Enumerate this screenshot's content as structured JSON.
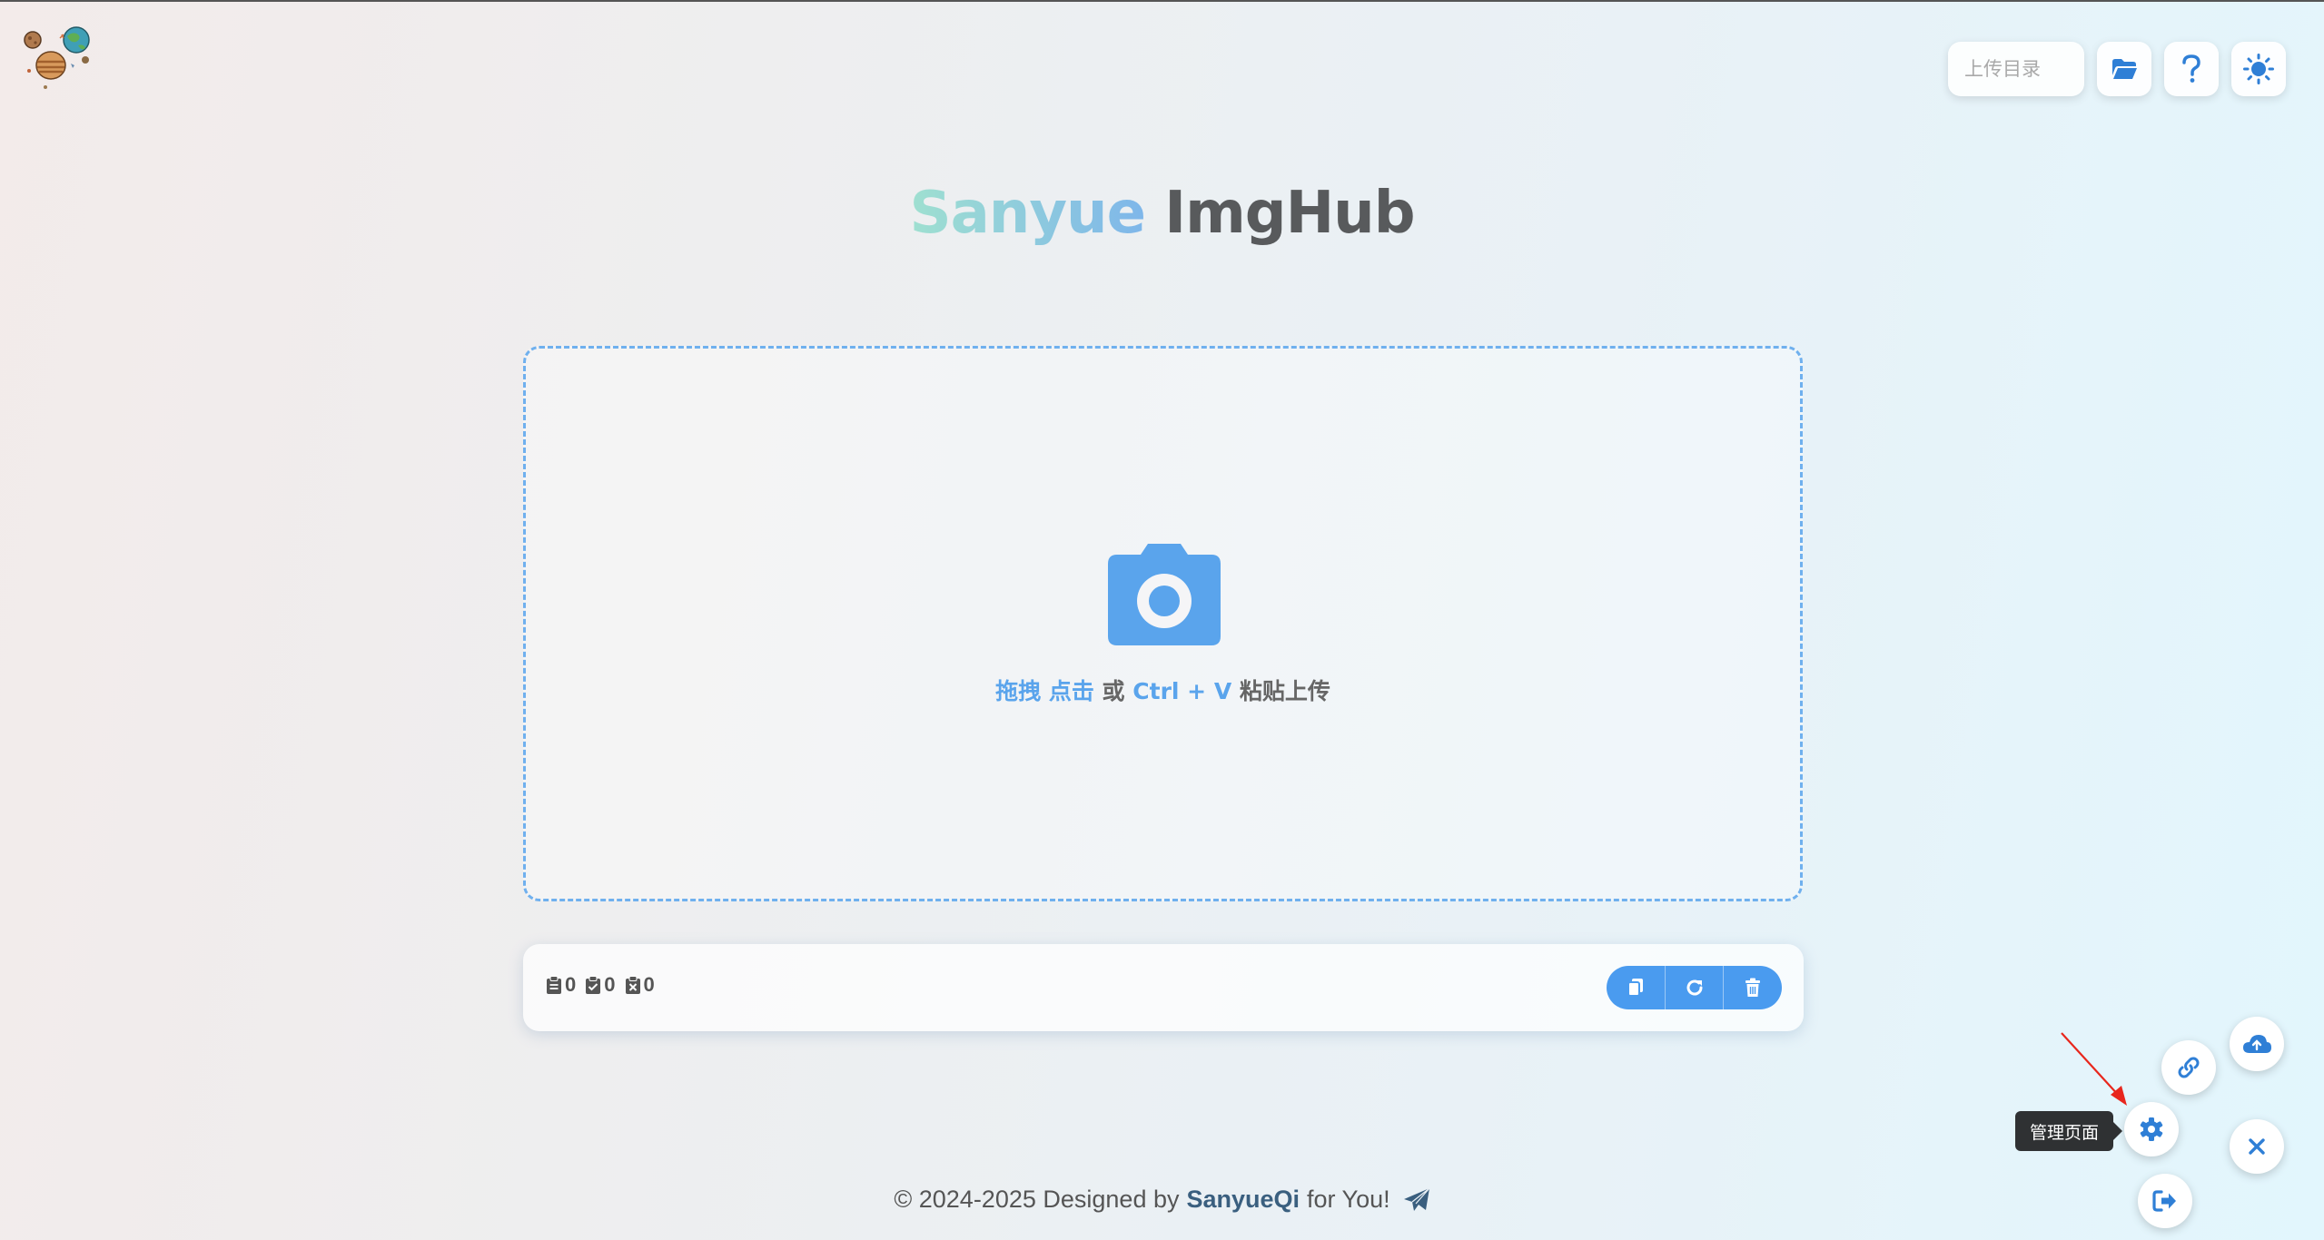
{
  "app": {
    "title_part1": "Sanyue",
    "title_part2": "ImgHub"
  },
  "topbar": {
    "upload_dir_placeholder": "上传目录",
    "icons": [
      "folder-open-icon",
      "question-icon",
      "sun-icon"
    ]
  },
  "dropzone": {
    "icon": "camera-icon",
    "text_drag": "拖拽",
    "text_click": "点击",
    "text_or": " 或 ",
    "text_shortcut": "Ctrl + V",
    "text_paste": " 粘贴上传"
  },
  "upload_status": {
    "total_count": "0",
    "success_count": "0",
    "failed_count": "0",
    "actions": [
      "copy-icon",
      "refresh-icon",
      "trash-icon"
    ]
  },
  "footer": {
    "prefix": "© 2024-2025 Designed by",
    "author": "SanyueQi",
    "suffix": "for You!"
  },
  "floating_menu": {
    "tooltip": "管理页面",
    "items": [
      "cloud-upload-icon",
      "link-icon",
      "gear-icon",
      "close-icon",
      "logout-icon"
    ]
  },
  "colors": {
    "accent": "#4a9bef",
    "dropzone_border": "#6fb0ee",
    "fab_icon": "#2f7fd6",
    "annotation_arrow": "#e8261c"
  }
}
